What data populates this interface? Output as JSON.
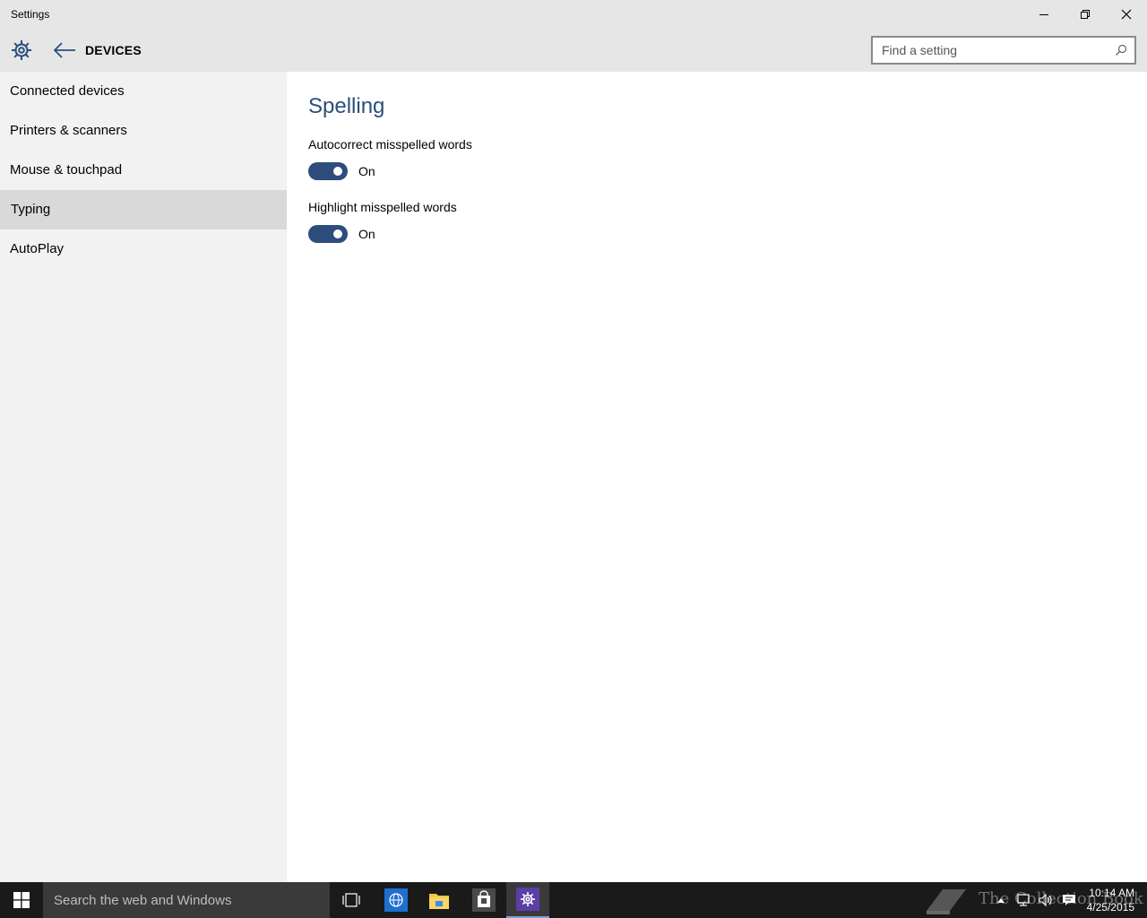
{
  "window": {
    "title": "Settings"
  },
  "header": {
    "section": "DEVICES",
    "search_placeholder": "Find a setting"
  },
  "sidebar": {
    "items": [
      {
        "label": "Connected devices"
      },
      {
        "label": "Printers & scanners"
      },
      {
        "label": "Mouse & touchpad"
      },
      {
        "label": "Typing"
      },
      {
        "label": "AutoPlay"
      }
    ],
    "selected": "Typing"
  },
  "content": {
    "heading": "Spelling",
    "settings": [
      {
        "label": "Autocorrect misspelled words",
        "state": "On"
      },
      {
        "label": "Highlight misspelled words",
        "state": "On"
      }
    ]
  },
  "taskbar": {
    "search_text": "Search the web and Windows",
    "watermark": "The Collection Book",
    "time": "10:14 AM",
    "date": "4/25/2015"
  },
  "colors": {
    "accent": "#2e4c7c",
    "heading": "#2b4e7a",
    "sidebar_bg": "#f2f2f2",
    "selected_bg": "#d9d9d9"
  }
}
